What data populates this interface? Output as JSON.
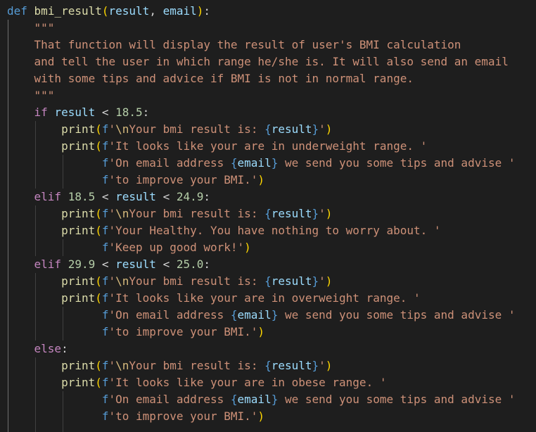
{
  "editor": {
    "theme_colors": {
      "background": "#1e1e1e",
      "keyword": "#569cd6",
      "control": "#c586c0",
      "function": "#dcdcaa",
      "parameter": "#9cdcfe",
      "string": "#ce9178",
      "number": "#b5cea8",
      "plain": "#d4d4d4",
      "bracket": "#ffd700",
      "brace": "#da70d6",
      "escape": "#d7ba7d"
    },
    "lines": [
      {
        "tokens": [
          {
            "type": "keyword",
            "text": "def"
          },
          {
            "type": "plain",
            "text": " "
          },
          {
            "type": "func",
            "text": "bmi_result"
          },
          {
            "type": "paren",
            "text": "("
          },
          {
            "type": "param",
            "text": "result"
          },
          {
            "type": "plain",
            "text": ", "
          },
          {
            "type": "param",
            "text": "email"
          },
          {
            "type": "paren",
            "text": ")"
          },
          {
            "type": "plain",
            "text": ":"
          }
        ]
      },
      {
        "tokens": [
          {
            "type": "plain",
            "text": "    "
          },
          {
            "type": "string",
            "text": "\"\"\""
          }
        ]
      },
      {
        "tokens": [
          {
            "type": "plain",
            "text": "    "
          },
          {
            "type": "string",
            "text": "That function will display the result of user's BMI calculation"
          }
        ]
      },
      {
        "tokens": [
          {
            "type": "plain",
            "text": "    "
          },
          {
            "type": "string",
            "text": "and tell the user in which range he/she is. It will also send an email"
          }
        ]
      },
      {
        "tokens": [
          {
            "type": "plain",
            "text": "    "
          },
          {
            "type": "string",
            "text": "with some tips and advice if BMI is not in normal range."
          }
        ]
      },
      {
        "tokens": [
          {
            "type": "plain",
            "text": "    "
          },
          {
            "type": "string",
            "text": "\"\"\""
          }
        ]
      },
      {
        "tokens": [
          {
            "type": "plain",
            "text": "    "
          },
          {
            "type": "control",
            "text": "if"
          },
          {
            "type": "plain",
            "text": " "
          },
          {
            "type": "param",
            "text": "result"
          },
          {
            "type": "plain",
            "text": " < "
          },
          {
            "type": "number",
            "text": "18.5"
          },
          {
            "type": "plain",
            "text": ":"
          }
        ]
      },
      {
        "tokens": [
          {
            "type": "plain",
            "text": "        "
          },
          {
            "type": "func",
            "text": "print"
          },
          {
            "type": "paren",
            "text": "("
          },
          {
            "type": "keyword",
            "text": "f"
          },
          {
            "type": "string",
            "text": "'"
          },
          {
            "type": "escape",
            "text": "\\n"
          },
          {
            "type": "string",
            "text": "Your bmi result is: "
          },
          {
            "type": "keyword",
            "text": "{"
          },
          {
            "type": "param",
            "text": "result"
          },
          {
            "type": "keyword",
            "text": "}"
          },
          {
            "type": "string",
            "text": "'"
          },
          {
            "type": "paren",
            "text": ")"
          }
        ]
      },
      {
        "tokens": [
          {
            "type": "plain",
            "text": "        "
          },
          {
            "type": "func",
            "text": "print"
          },
          {
            "type": "paren",
            "text": "("
          },
          {
            "type": "keyword",
            "text": "f"
          },
          {
            "type": "string",
            "text": "'It looks like your are in underweight range. '"
          }
        ]
      },
      {
        "tokens": [
          {
            "type": "plain",
            "text": "              "
          },
          {
            "type": "keyword",
            "text": "f"
          },
          {
            "type": "string",
            "text": "'On email address "
          },
          {
            "type": "keyword",
            "text": "{"
          },
          {
            "type": "param",
            "text": "email"
          },
          {
            "type": "keyword",
            "text": "}"
          },
          {
            "type": "string",
            "text": " we send you some tips and advise '"
          }
        ]
      },
      {
        "tokens": [
          {
            "type": "plain",
            "text": "              "
          },
          {
            "type": "keyword",
            "text": "f"
          },
          {
            "type": "string",
            "text": "'to improve your BMI.'"
          },
          {
            "type": "paren",
            "text": ")"
          }
        ]
      },
      {
        "tokens": [
          {
            "type": "plain",
            "text": "    "
          },
          {
            "type": "control",
            "text": "elif"
          },
          {
            "type": "plain",
            "text": " "
          },
          {
            "type": "number",
            "text": "18.5"
          },
          {
            "type": "plain",
            "text": " < "
          },
          {
            "type": "param",
            "text": "result"
          },
          {
            "type": "plain",
            "text": " < "
          },
          {
            "type": "number",
            "text": "24.9"
          },
          {
            "type": "plain",
            "text": ":"
          }
        ]
      },
      {
        "tokens": [
          {
            "type": "plain",
            "text": "        "
          },
          {
            "type": "func",
            "text": "print"
          },
          {
            "type": "paren",
            "text": "("
          },
          {
            "type": "keyword",
            "text": "f"
          },
          {
            "type": "string",
            "text": "'"
          },
          {
            "type": "escape",
            "text": "\\n"
          },
          {
            "type": "string",
            "text": "Your bmi result is: "
          },
          {
            "type": "keyword",
            "text": "{"
          },
          {
            "type": "param",
            "text": "result"
          },
          {
            "type": "keyword",
            "text": "}"
          },
          {
            "type": "string",
            "text": "'"
          },
          {
            "type": "paren",
            "text": ")"
          }
        ]
      },
      {
        "tokens": [
          {
            "type": "plain",
            "text": "        "
          },
          {
            "type": "func",
            "text": "print"
          },
          {
            "type": "paren",
            "text": "("
          },
          {
            "type": "keyword",
            "text": "f"
          },
          {
            "type": "string",
            "text": "'Your Healthy. You have nothing to worry about. '"
          }
        ]
      },
      {
        "tokens": [
          {
            "type": "plain",
            "text": "              "
          },
          {
            "type": "keyword",
            "text": "f"
          },
          {
            "type": "string",
            "text": "'Keep up good work!'"
          },
          {
            "type": "paren",
            "text": ")"
          }
        ]
      },
      {
        "tokens": [
          {
            "type": "plain",
            "text": "    "
          },
          {
            "type": "control",
            "text": "elif"
          },
          {
            "type": "plain",
            "text": " "
          },
          {
            "type": "number",
            "text": "29.9"
          },
          {
            "type": "plain",
            "text": " < "
          },
          {
            "type": "param",
            "text": "result"
          },
          {
            "type": "plain",
            "text": " < "
          },
          {
            "type": "number",
            "text": "25.0"
          },
          {
            "type": "plain",
            "text": ":"
          }
        ]
      },
      {
        "tokens": [
          {
            "type": "plain",
            "text": "        "
          },
          {
            "type": "func",
            "text": "print"
          },
          {
            "type": "paren",
            "text": "("
          },
          {
            "type": "keyword",
            "text": "f"
          },
          {
            "type": "string",
            "text": "'"
          },
          {
            "type": "escape",
            "text": "\\n"
          },
          {
            "type": "string",
            "text": "Your bmi result is: "
          },
          {
            "type": "keyword",
            "text": "{"
          },
          {
            "type": "param",
            "text": "result"
          },
          {
            "type": "keyword",
            "text": "}"
          },
          {
            "type": "string",
            "text": "'"
          },
          {
            "type": "paren",
            "text": ")"
          }
        ]
      },
      {
        "tokens": [
          {
            "type": "plain",
            "text": "        "
          },
          {
            "type": "func",
            "text": "print"
          },
          {
            "type": "paren",
            "text": "("
          },
          {
            "type": "keyword",
            "text": "f"
          },
          {
            "type": "string",
            "text": "'It looks like your are in overweight range. '"
          }
        ]
      },
      {
        "tokens": [
          {
            "type": "plain",
            "text": "              "
          },
          {
            "type": "keyword",
            "text": "f"
          },
          {
            "type": "string",
            "text": "'On email address "
          },
          {
            "type": "keyword",
            "text": "{"
          },
          {
            "type": "param",
            "text": "email"
          },
          {
            "type": "keyword",
            "text": "}"
          },
          {
            "type": "string",
            "text": " we send you some tips and advise '"
          }
        ]
      },
      {
        "tokens": [
          {
            "type": "plain",
            "text": "              "
          },
          {
            "type": "keyword",
            "text": "f"
          },
          {
            "type": "string",
            "text": "'to improve your BMI.'"
          },
          {
            "type": "paren",
            "text": ")"
          }
        ]
      },
      {
        "tokens": [
          {
            "type": "plain",
            "text": "    "
          },
          {
            "type": "control",
            "text": "else"
          },
          {
            "type": "plain",
            "text": ":"
          }
        ]
      },
      {
        "tokens": [
          {
            "type": "plain",
            "text": "        "
          },
          {
            "type": "func",
            "text": "print"
          },
          {
            "type": "paren",
            "text": "("
          },
          {
            "type": "keyword",
            "text": "f"
          },
          {
            "type": "string",
            "text": "'"
          },
          {
            "type": "escape",
            "text": "\\n"
          },
          {
            "type": "string",
            "text": "Your bmi result is: "
          },
          {
            "type": "keyword",
            "text": "{"
          },
          {
            "type": "param",
            "text": "result"
          },
          {
            "type": "keyword",
            "text": "}"
          },
          {
            "type": "string",
            "text": "'"
          },
          {
            "type": "paren",
            "text": ")"
          }
        ]
      },
      {
        "tokens": [
          {
            "type": "plain",
            "text": "        "
          },
          {
            "type": "func",
            "text": "print"
          },
          {
            "type": "paren",
            "text": "("
          },
          {
            "type": "keyword",
            "text": "f"
          },
          {
            "type": "string",
            "text": "'It looks like your are in obese range. '"
          }
        ]
      },
      {
        "tokens": [
          {
            "type": "plain",
            "text": "              "
          },
          {
            "type": "keyword",
            "text": "f"
          },
          {
            "type": "string",
            "text": "'On email address "
          },
          {
            "type": "keyword",
            "text": "{"
          },
          {
            "type": "param",
            "text": "email"
          },
          {
            "type": "keyword",
            "text": "}"
          },
          {
            "type": "string",
            "text": " we send you some tips and advise '"
          }
        ]
      },
      {
        "tokens": [
          {
            "type": "plain",
            "text": "              "
          },
          {
            "type": "keyword",
            "text": "f"
          },
          {
            "type": "string",
            "text": "'to improve your BMI.'"
          },
          {
            "type": "paren",
            "text": ")"
          }
        ]
      }
    ]
  }
}
